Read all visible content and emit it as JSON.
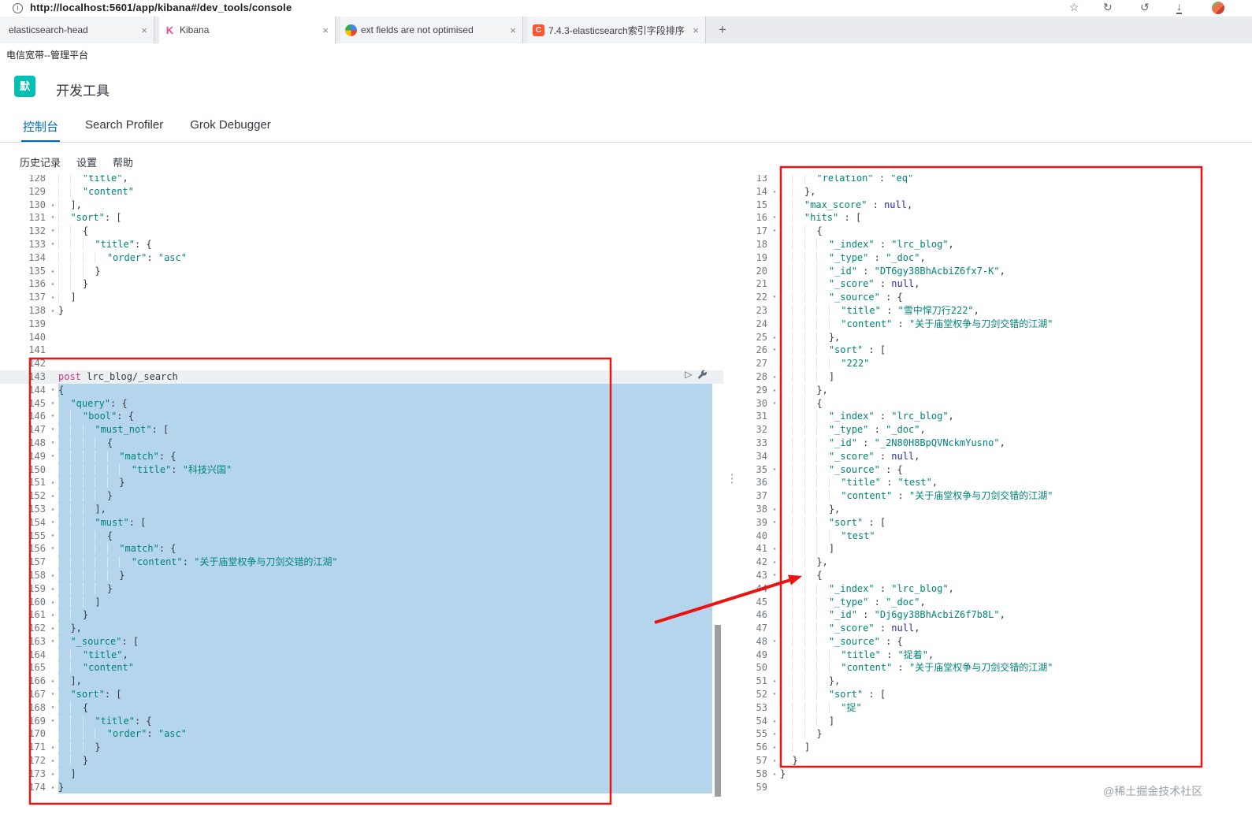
{
  "colors": {
    "accent": "#006bb4",
    "badge": "#00bfb3",
    "string": "#008475",
    "method": "#c4367f",
    "null_literal": "#2929a3",
    "selection": "#b4d5eb",
    "annotation": "#eb1212",
    "csdn": "#fc5531",
    "kibana_pink": "#e8488b"
  },
  "icons": {
    "info": "i",
    "star": "☆",
    "reload": "↻",
    "history": "↺",
    "download": "↓",
    "close": "×",
    "new_tab": "+",
    "overflow": "⋮",
    "play": "▷",
    "fold_open": "▾",
    "fold_close": "▴"
  },
  "browser": {
    "url": "http://localhost:5601/app/kibana#/dev_tools/console",
    "active_tab": 1,
    "tabs": [
      {
        "label": "elasticsearch-head",
        "favicon": "none"
      },
      {
        "label": "Kibana",
        "favicon": "kibana"
      },
      {
        "label": "ext fields are not optimised",
        "favicon": "colorful"
      },
      {
        "label": "7.4.3-elasticsearch索引字段排序",
        "favicon": "csdn"
      }
    ],
    "bookmark": "电信宽带--管理平台"
  },
  "app": {
    "badge": "默",
    "title": "开发工具",
    "nav_tabs": [
      {
        "label": "控制台",
        "name": "console",
        "active": true
      },
      {
        "label": "Search Profiler",
        "name": "search-profiler",
        "active": false
      },
      {
        "label": "Grok Debugger",
        "name": "grok-debugger",
        "active": false
      }
    ],
    "menu": [
      {
        "label": "历史记录",
        "name": "history"
      },
      {
        "label": "设置",
        "name": "settings"
      },
      {
        "label": "帮助",
        "name": "help"
      }
    ]
  },
  "request_editor": {
    "lines": [
      {
        "n": 128,
        "f": "",
        "t": "    \"title\","
      },
      {
        "n": 129,
        "f": "",
        "t": "    \"content\""
      },
      {
        "n": 130,
        "f": "u",
        "t": "  ],"
      },
      {
        "n": 131,
        "f": "d",
        "t": "  \"sort\": ["
      },
      {
        "n": 132,
        "f": "d",
        "t": "    {"
      },
      {
        "n": 133,
        "f": "d",
        "t": "      \"title\": {"
      },
      {
        "n": 134,
        "f": "",
        "t": "        \"order\": \"asc\""
      },
      {
        "n": 135,
        "f": "u",
        "t": "      }"
      },
      {
        "n": 136,
        "f": "u",
        "t": "    }"
      },
      {
        "n": 137,
        "f": "u",
        "t": "  ]"
      },
      {
        "n": 138,
        "f": "u",
        "t": "}"
      },
      {
        "n": 139,
        "f": "",
        "t": ""
      },
      {
        "n": 140,
        "f": "",
        "t": ""
      },
      {
        "n": 141,
        "f": "",
        "t": ""
      },
      {
        "n": 142,
        "f": "",
        "t": ""
      },
      {
        "n": 143,
        "f": "",
        "a": 1,
        "t": "post lrc_blog/_search"
      },
      {
        "n": 144,
        "f": "d",
        "s": 1,
        "t": "{"
      },
      {
        "n": 145,
        "f": "d",
        "s": 1,
        "t": "  \"query\": {"
      },
      {
        "n": 146,
        "f": "d",
        "s": 1,
        "t": "    \"bool\": {"
      },
      {
        "n": 147,
        "f": "d",
        "s": 1,
        "t": "      \"must_not\": ["
      },
      {
        "n": 148,
        "f": "d",
        "s": 1,
        "t": "        {"
      },
      {
        "n": 149,
        "f": "d",
        "s": 1,
        "t": "          \"match\": {"
      },
      {
        "n": 150,
        "f": "",
        "s": 1,
        "t": "            \"title\": \"科技兴国\""
      },
      {
        "n": 151,
        "f": "u",
        "s": 1,
        "t": "          }"
      },
      {
        "n": 152,
        "f": "u",
        "s": 1,
        "t": "        }"
      },
      {
        "n": 153,
        "f": "u",
        "s": 1,
        "t": "      ],"
      },
      {
        "n": 154,
        "f": "d",
        "s": 1,
        "t": "      \"must\": ["
      },
      {
        "n": 155,
        "f": "d",
        "s": 1,
        "t": "        {"
      },
      {
        "n": 156,
        "f": "d",
        "s": 1,
        "t": "          \"match\": {"
      },
      {
        "n": 157,
        "f": "",
        "s": 1,
        "t": "            \"content\": \"关于庙堂权争与刀剑交错的江湖\""
      },
      {
        "n": 158,
        "f": "u",
        "s": 1,
        "t": "          }"
      },
      {
        "n": 159,
        "f": "u",
        "s": 1,
        "t": "        }"
      },
      {
        "n": 160,
        "f": "u",
        "s": 1,
        "t": "      ]"
      },
      {
        "n": 161,
        "f": "u",
        "s": 1,
        "t": "    }"
      },
      {
        "n": 162,
        "f": "u",
        "s": 1,
        "t": "  },"
      },
      {
        "n": 163,
        "f": "d",
        "s": 1,
        "t": "  \"_source\": ["
      },
      {
        "n": 164,
        "f": "",
        "s": 1,
        "t": "    \"title\","
      },
      {
        "n": 165,
        "f": "",
        "s": 1,
        "t": "    \"content\""
      },
      {
        "n": 166,
        "f": "u",
        "s": 1,
        "t": "  ],"
      },
      {
        "n": 167,
        "f": "d",
        "s": 1,
        "t": "  \"sort\": ["
      },
      {
        "n": 168,
        "f": "d",
        "s": 1,
        "t": "    {"
      },
      {
        "n": 169,
        "f": "d",
        "s": 1,
        "t": "      \"title\": {"
      },
      {
        "n": 170,
        "f": "",
        "s": 1,
        "t": "        \"order\": \"asc\""
      },
      {
        "n": 171,
        "f": "u",
        "s": 1,
        "t": "      }"
      },
      {
        "n": 172,
        "f": "u",
        "s": 1,
        "t": "    }"
      },
      {
        "n": 173,
        "f": "u",
        "s": 1,
        "t": "  ]"
      },
      {
        "n": 174,
        "f": "u",
        "s": 1,
        "t": "}"
      }
    ]
  },
  "response_viewer": {
    "lines": [
      {
        "n": 13,
        "f": "",
        "t": "      \"relation\" : \"eq\""
      },
      {
        "n": 14,
        "f": "u",
        "t": "    },"
      },
      {
        "n": 15,
        "f": "",
        "t": "    \"max_score\" : null,"
      },
      {
        "n": 16,
        "f": "d",
        "t": "    \"hits\" : ["
      },
      {
        "n": 17,
        "f": "d",
        "t": "      {"
      },
      {
        "n": 18,
        "f": "",
        "t": "        \"_index\" : \"lrc_blog\","
      },
      {
        "n": 19,
        "f": "",
        "t": "        \"_type\" : \"_doc\","
      },
      {
        "n": 20,
        "f": "",
        "t": "        \"_id\" : \"DT6gy38BhAcbiZ6fx7-K\","
      },
      {
        "n": 21,
        "f": "",
        "t": "        \"_score\" : null,"
      },
      {
        "n": 22,
        "f": "d",
        "t": "        \"_source\" : {"
      },
      {
        "n": 23,
        "f": "",
        "t": "          \"title\" : \"雪中悍刀行222\","
      },
      {
        "n": 24,
        "f": "",
        "t": "          \"content\" : \"关于庙堂权争与刀剑交错的江湖\""
      },
      {
        "n": 25,
        "f": "u",
        "t": "        },"
      },
      {
        "n": 26,
        "f": "d",
        "t": "        \"sort\" : ["
      },
      {
        "n": 27,
        "f": "",
        "t": "          \"222\""
      },
      {
        "n": 28,
        "f": "u",
        "t": "        ]"
      },
      {
        "n": 29,
        "f": "u",
        "t": "      },"
      },
      {
        "n": 30,
        "f": "d",
        "t": "      {"
      },
      {
        "n": 31,
        "f": "",
        "t": "        \"_index\" : \"lrc_blog\","
      },
      {
        "n": 32,
        "f": "",
        "t": "        \"_type\" : \"_doc\","
      },
      {
        "n": 33,
        "f": "",
        "t": "        \"_id\" : \"_2N80H8BpQVNckmYusno\","
      },
      {
        "n": 34,
        "f": "",
        "t": "        \"_score\" : null,"
      },
      {
        "n": 35,
        "f": "d",
        "t": "        \"_source\" : {"
      },
      {
        "n": 36,
        "f": "",
        "t": "          \"title\" : \"test\","
      },
      {
        "n": 37,
        "f": "",
        "t": "          \"content\" : \"关于庙堂权争与刀剑交错的江湖\""
      },
      {
        "n": 38,
        "f": "u",
        "t": "        },"
      },
      {
        "n": 39,
        "f": "d",
        "t": "        \"sort\" : ["
      },
      {
        "n": 40,
        "f": "",
        "t": "          \"test\""
      },
      {
        "n": 41,
        "f": "u",
        "t": "        ]"
      },
      {
        "n": 42,
        "f": "u",
        "t": "      },"
      },
      {
        "n": 43,
        "f": "d",
        "t": "      {"
      },
      {
        "n": 44,
        "f": "",
        "t": "        \"_index\" : \"lrc_blog\","
      },
      {
        "n": 45,
        "f": "",
        "t": "        \"_type\" : \"_doc\","
      },
      {
        "n": 46,
        "f": "",
        "t": "        \"_id\" : \"Dj6gy38BhAcbiZ6f7b8L\","
      },
      {
        "n": 47,
        "f": "",
        "t": "        \"_score\" : null,"
      },
      {
        "n": 48,
        "f": "d",
        "t": "        \"_source\" : {"
      },
      {
        "n": 49,
        "f": "",
        "t": "          \"title\" : \"捉着\","
      },
      {
        "n": 50,
        "f": "",
        "t": "          \"content\" : \"关于庙堂权争与刀剑交错的江湖\""
      },
      {
        "n": 51,
        "f": "u",
        "t": "        },"
      },
      {
        "n": 52,
        "f": "d",
        "t": "        \"sort\" : ["
      },
      {
        "n": 53,
        "f": "",
        "t": "          \"捉\""
      },
      {
        "n": 54,
        "f": "u",
        "t": "        ]"
      },
      {
        "n": 55,
        "f": "u",
        "t": "      }"
      },
      {
        "n": 56,
        "f": "u",
        "t": "    ]"
      },
      {
        "n": 57,
        "f": "u",
        "t": "  }"
      },
      {
        "n": 58,
        "f": "u",
        "t": "}"
      },
      {
        "n": 59,
        "f": "",
        "t": ""
      }
    ]
  },
  "watermark": "@稀土掘金技术社区"
}
